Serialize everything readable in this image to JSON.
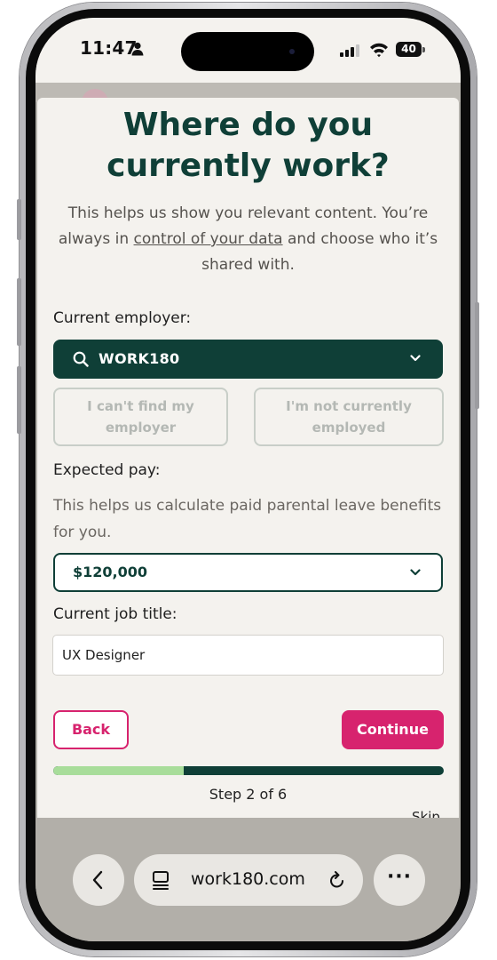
{
  "status_bar": {
    "time": "11:47",
    "battery": "40"
  },
  "page": {
    "title": "Where do you currently work?",
    "subtitle_pre": "This helps us show you relevant content. You’re always in ",
    "subtitle_link": "control of your data",
    "subtitle_post": " and choose who it’s shared with."
  },
  "employer": {
    "label": "Current employer:",
    "value": "WORK180",
    "cant_find": "I can't find my employer",
    "not_employed": "I'm not currently employed"
  },
  "pay": {
    "label": "Expected pay:",
    "helper": "This helps us calculate paid parental leave benefits for you.",
    "value": "$120,000"
  },
  "job_title": {
    "label": "Current job title:",
    "value": "UX Designer"
  },
  "actions": {
    "back": "Back",
    "continue": "Continue"
  },
  "progress": {
    "step_text": "Step 2 of 6",
    "fraction": 0.333
  },
  "skip": "Skip",
  "browser": {
    "url": "work180.com",
    "more": "···"
  },
  "colors": {
    "brand_dark": "#0f3f37",
    "accent_pink": "#d7236e",
    "progress_green": "#a8dd9a"
  }
}
